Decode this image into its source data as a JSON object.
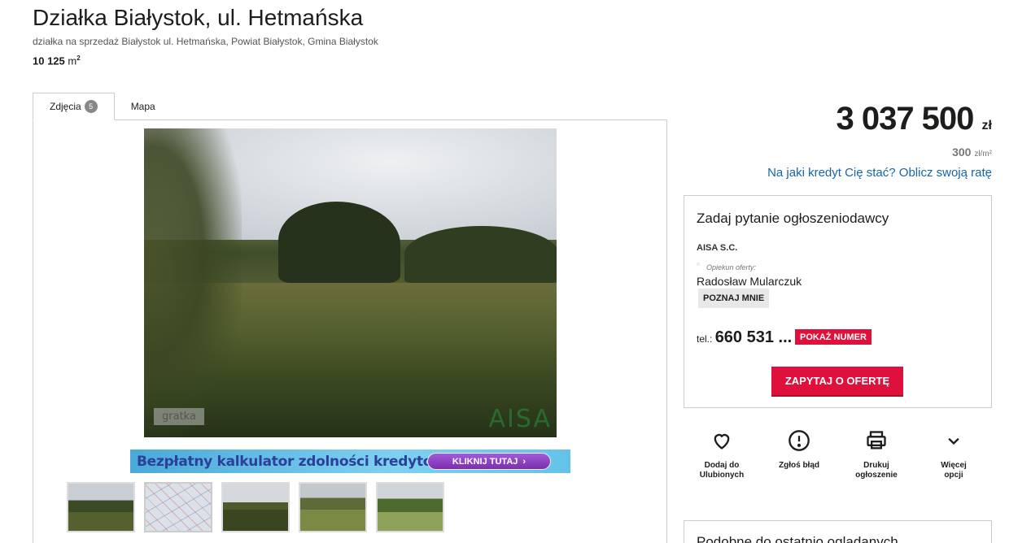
{
  "listing": {
    "title": "Działka Białystok, ul. Hetmańska",
    "subtitle": "działka na sprzedaż Białystok ul. Hetmańska, Powiat Białystok, Gmina Białystok",
    "area_value": "10 125",
    "area_unit": "m",
    "area_sup": "2"
  },
  "tabs": [
    {
      "label": "Zdjęcia",
      "badge": "5",
      "active": true
    },
    {
      "label": "Mapa",
      "active": false
    }
  ],
  "gallery": {
    "watermark_left": "gratka",
    "watermark_right": "AISA",
    "banner_text": "Bezpłatny kalkulator zdolności kredytowej!",
    "banner_button": "KLIKNIJ TUTAJ",
    "thumbnail_count": 5
  },
  "price": {
    "amount": "3 037 500",
    "currency": "zł",
    "per_m2_value": "300",
    "per_m2_unit": "zł/m²",
    "credit_link": "Na jaki kredyt Cię stać? Oblicz swoją ratę"
  },
  "contact": {
    "title": "Zadaj pytanie ogłoszeniodawcy",
    "agency": "AISA S.C.",
    "agent_caption": "Opiekun oferty:",
    "agent_name": "Radosław Mularczuk",
    "meet_button": "POZNAJ MNIE",
    "tel_label": "tel.:",
    "tel_number": "660 531 ...",
    "show_number_button": "POKAŻ NUMER",
    "ask_button": "ZAPYTAJ O OFERTĘ"
  },
  "actions": [
    {
      "icon": "heart-icon",
      "line1": "Dodaj do",
      "line2": "Ulubionych"
    },
    {
      "icon": "alert-circle-icon",
      "line1": "Zgłoś błąd",
      "line2": ""
    },
    {
      "icon": "printer-icon",
      "line1": "Drukuj",
      "line2": "ogłoszenie"
    },
    {
      "icon": "chevron-down-icon",
      "line1": "Więcej",
      "line2": "opcji"
    }
  ],
  "similar": {
    "title": "Podobne do ostatnio oglądanych"
  },
  "colors": {
    "accent_red": "#e0103c",
    "link_blue": "#1565a9",
    "border_gray": "#cccccc"
  }
}
